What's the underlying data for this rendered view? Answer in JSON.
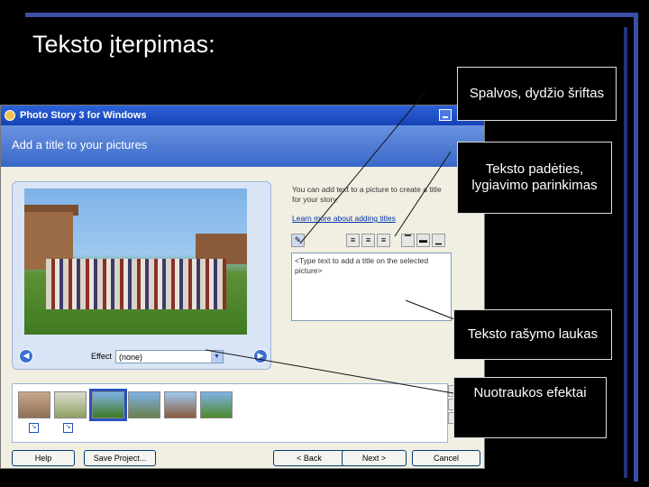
{
  "slide": {
    "title": "Teksto įterpimas:"
  },
  "window": {
    "title": "Photo Story 3 for Windows",
    "header": "Add a title to your pictures",
    "info_text": "You can add text to a picture to create a title for your story.",
    "learn_link": "Learn more about adding titles",
    "text_area": "<Type text to add a title on the selected picture>",
    "effect_label": "Effect",
    "effect_value": "(none)",
    "buttons": {
      "help": "Help",
      "save": "Save Project...",
      "back": "< Back",
      "next": "Next >",
      "cancel": "Cancel"
    }
  },
  "callouts": {
    "font": "Spalvos, dydžio šriftas",
    "position": "Teksto padėties, lygiavimo parinkimas",
    "text_field": "Teksto rašymo laukas",
    "effects": "Nuotraukos efektai"
  },
  "colors": {
    "slide_bg": "#000000",
    "accent_bar": "#3a4fa8",
    "titlebar": "#1542b6",
    "header": "#3867c8"
  }
}
